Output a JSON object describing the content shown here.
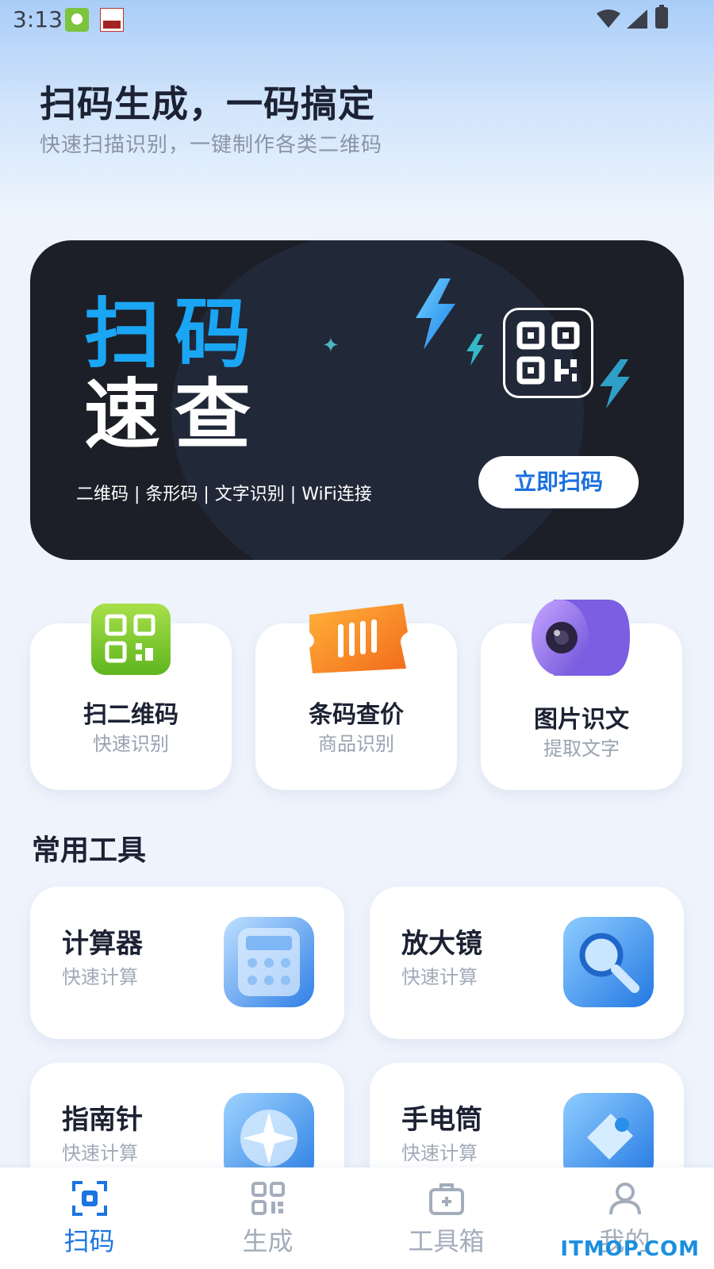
{
  "status_bar": {
    "time": "3:13"
  },
  "header": {
    "title": "扫码生成，一码搞定",
    "subtitle": "快速扫描识别，一键制作各类二维码"
  },
  "banner": {
    "line1": "扫码",
    "line2": "速查",
    "tags": "二维码 | 条形码 | 文字识别 | WiFi连接",
    "button_label": "立即扫码"
  },
  "features": [
    {
      "title": "扫二维码",
      "subtitle": "快速识别",
      "icon": "qr-code-icon"
    },
    {
      "title": "条码查价",
      "subtitle": "商品识别",
      "icon": "barcode-ticket-icon"
    },
    {
      "title": "图片识文",
      "subtitle": "提取文字",
      "icon": "camera-lens-icon"
    }
  ],
  "tools_section": {
    "title": "常用工具",
    "tools": [
      {
        "name": "计算器",
        "subtitle": "快速计算",
        "icon": "calculator-icon"
      },
      {
        "name": "放大镜",
        "subtitle": "快速计算",
        "icon": "magnifier-icon"
      },
      {
        "name": "指南针",
        "subtitle": "快速计算",
        "icon": "compass-icon"
      },
      {
        "name": "手电筒",
        "subtitle": "快速计算",
        "icon": "flashlight-icon"
      }
    ]
  },
  "bottom_nav": {
    "items": [
      {
        "label": "扫码",
        "icon": "scan-icon",
        "active": true
      },
      {
        "label": "生成",
        "icon": "qr-grid-icon",
        "active": false
      },
      {
        "label": "工具箱",
        "icon": "toolbox-icon",
        "active": false
      },
      {
        "label": "我的",
        "icon": "user-icon",
        "active": false
      }
    ]
  },
  "watermark": "ITMOP.COM",
  "colors": {
    "accent": "#1c74e0",
    "banner_bg": "#1c1f27",
    "banner_highlight": "#1aa6f4",
    "page_bg": "#eef3fc"
  }
}
